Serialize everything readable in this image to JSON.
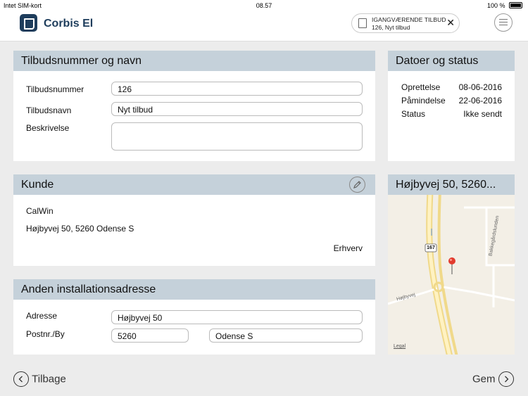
{
  "statusbar": {
    "carrier": "Intet SIM-kort",
    "time": "08.57",
    "battery": "100 %"
  },
  "header": {
    "app_title": "Corbis El",
    "active_offer": {
      "label": "IGANGVÆRENDE TILBUD",
      "value": "126, Nyt tilbud"
    }
  },
  "offer": {
    "title": "Tilbudsnummer og navn",
    "number_label": "Tilbudsnummer",
    "number_value": "126",
    "name_label": "Tilbudsnavn",
    "name_value": "Nyt tilbud",
    "desc_label": "Beskrivelse",
    "desc_value": ""
  },
  "dates": {
    "title": "Datoer og status",
    "created_label": "Oprettelse",
    "created_value": "08-06-2016",
    "reminder_label": "Påmindelse",
    "reminder_value": "22-06-2016",
    "status_label": "Status",
    "status_value": "Ikke sendt"
  },
  "customer": {
    "title": "Kunde",
    "name": "CalWin",
    "address": "Højbyvej 50, 5260 Odense S",
    "type": "Erhverv"
  },
  "map_card": {
    "title": "Højbyvej 50, 5260...",
    "road_number": "167",
    "street_labels": [
      "Højbyvej",
      "Bakkegårdslunden"
    ],
    "legal": "Legal"
  },
  "install": {
    "title": "Anden installationsadresse",
    "address_label": "Adresse",
    "address_value": "Højbyvej 50",
    "zipcity_label": "Postnr./By",
    "zip_value": "5260",
    "city_value": "Odense S"
  },
  "footer": {
    "back_label": "Tilbage",
    "save_label": "Gem"
  },
  "colors": {
    "brand": "#1e3d5c",
    "section_header": "#c5d1da",
    "background": "#ececec"
  }
}
